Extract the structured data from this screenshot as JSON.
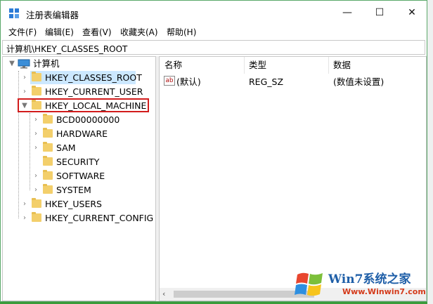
{
  "window": {
    "title": "注册表编辑器"
  },
  "menu": [
    "文件(F)",
    "编辑(E)",
    "查看(V)",
    "收藏夹(A)",
    "帮助(H)"
  ],
  "address": "计算机\\HKEY_CLASSES_ROOT",
  "tree": {
    "root": "计算机",
    "hives": [
      "HKEY_CLASSES_ROOT",
      "HKEY_CURRENT_USER",
      "HKEY_LOCAL_MACHINE"
    ],
    "local_machine_children": [
      "BCD00000000",
      "HARDWARE",
      "SAM",
      "SECURITY",
      "SOFTWARE",
      "SYSTEM"
    ],
    "other_hives": [
      "HKEY_USERS",
      "HKEY_CURRENT_CONFIG"
    ]
  },
  "list": {
    "headers": {
      "name": "名称",
      "type": "类型",
      "data": "数据"
    },
    "rows": [
      {
        "name": "(默认)",
        "type": "REG_SZ",
        "data": "(数值未设置)"
      }
    ]
  },
  "watermark": {
    "brand": "Win7系统之家",
    "url": "Www.Winwin7.com"
  }
}
